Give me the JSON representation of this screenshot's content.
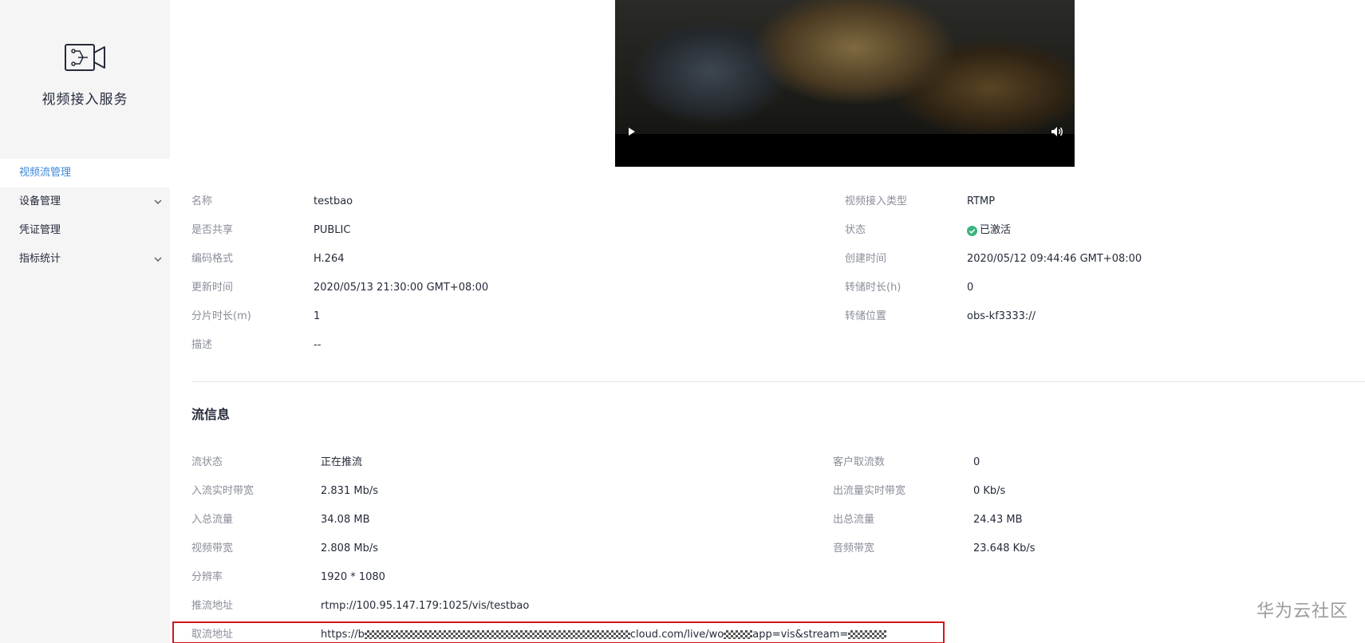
{
  "sidebar": {
    "service_title": "视频接入服务",
    "items": [
      {
        "label": "视频流管理",
        "active": true,
        "expandable": false
      },
      {
        "label": "设备管理",
        "active": false,
        "expandable": true
      },
      {
        "label": "凭证管理",
        "active": false,
        "expandable": false
      },
      {
        "label": "指标统计",
        "active": false,
        "expandable": true
      }
    ]
  },
  "video": {
    "play_icon": "play-icon",
    "volume_icon": "volume-icon"
  },
  "details": {
    "name_label": "名称",
    "name_value": "testbao",
    "type_label": "视频接入类型",
    "type_value": "RTMP",
    "share_label": "是否共享",
    "share_value": "PUBLIC",
    "status_label": "状态",
    "status_value": "已激活",
    "codec_label": "编码格式",
    "codec_value": "H.264",
    "created_label": "创建时间",
    "created_value": "2020/05/12 09:44:46 GMT+08:00",
    "updated_label": "更新时间",
    "updated_value": "2020/05/13 21:30:00 GMT+08:00",
    "dump_duration_label": "转储时长(h)",
    "dump_duration_value": "0",
    "segment_label": "分片时长(m)",
    "segment_value": "1",
    "dump_location_label": "转储位置",
    "dump_location_value": "obs-kf3333://",
    "desc_label": "描述",
    "desc_value": "--"
  },
  "stream": {
    "section_title": "流信息",
    "status_label": "流状态",
    "status_value": "正在推流",
    "clients_label": "客户取流数",
    "clients_value": "0",
    "in_bw_label": "入流实时带宽",
    "in_bw_value": "2.831 Mb/s",
    "out_bw_label": "出流量实时带宽",
    "out_bw_value": "0 Kb/s",
    "in_total_label": "入总流量",
    "in_total_value": "34.08 MB",
    "out_total_label": "出总流量",
    "out_total_value": "24.43 MB",
    "video_bw_label": "视频带宽",
    "video_bw_value": "2.808 Mb/s",
    "audio_bw_label": "音频带宽",
    "audio_bw_value": "23.648 Kb/s",
    "resolution_label": "分辨率",
    "resolution_value": "1920 * 1080",
    "push_url_label": "推流地址",
    "push_url_value": "rtmp://100.95.147.179:1025/vis/testbao",
    "pull_url_label": "取流地址",
    "pull_url_parts": [
      "https://b",
      "cloud.com/live/wo",
      "app=vis&stream="
    ]
  },
  "colors": {
    "accent": "#526ecc",
    "status_ok": "#3ab57f",
    "highlight_border": "#d0171b"
  },
  "watermark": "华为云社区"
}
